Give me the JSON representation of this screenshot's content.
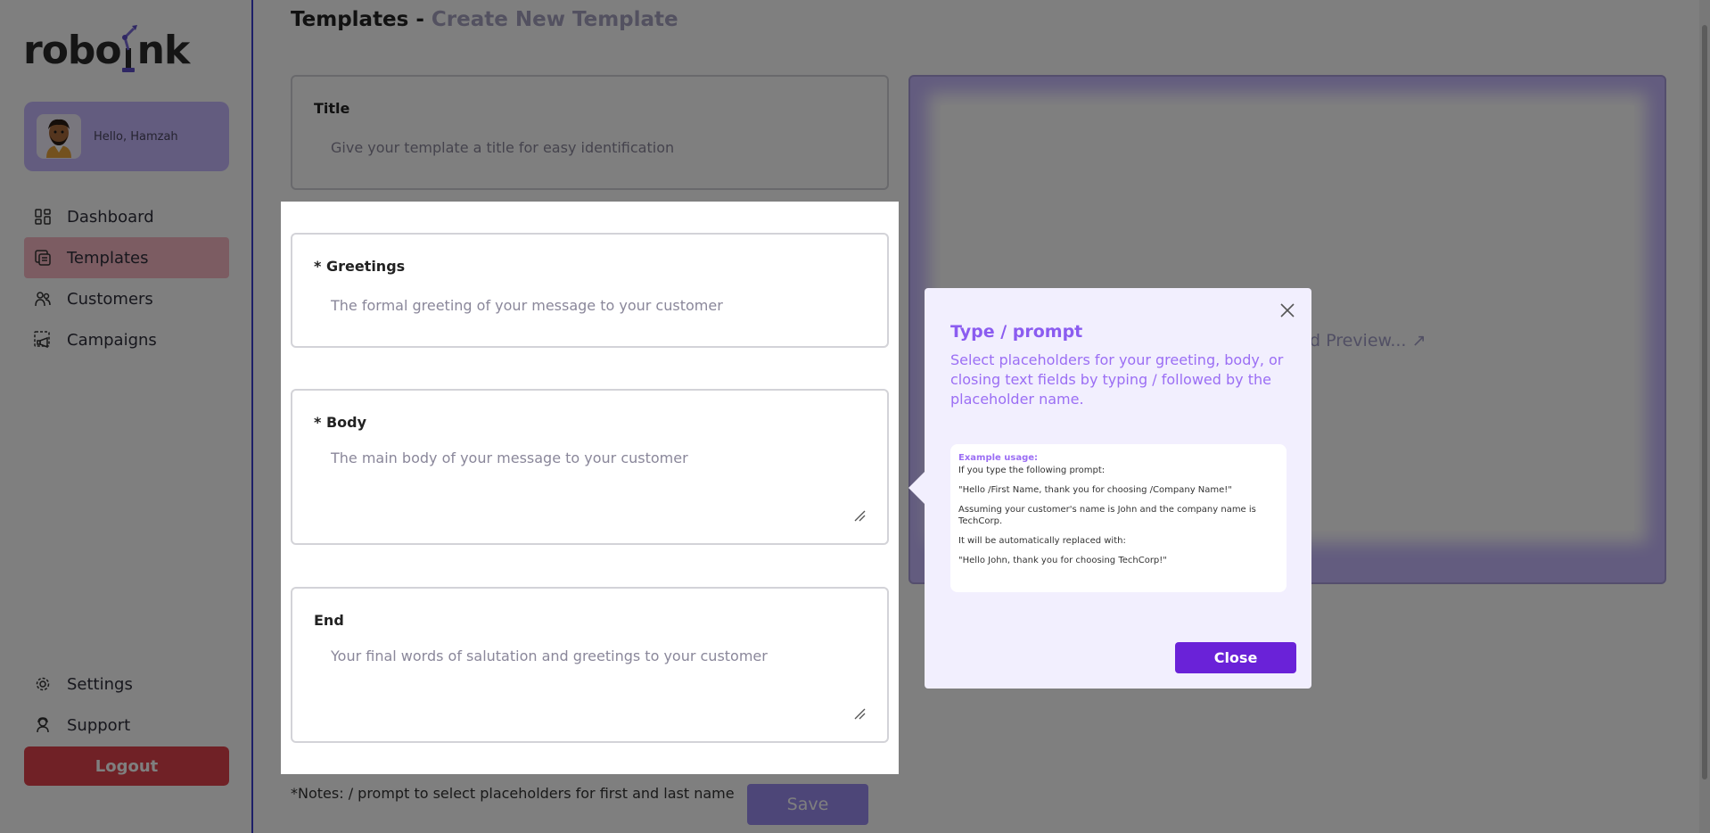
{
  "brand": {
    "logo_text_left": "robo",
    "logo_text_right": "nk"
  },
  "user": {
    "greeting": "Hello, Hamzah"
  },
  "sidebar": {
    "items": [
      {
        "label": "Dashboard",
        "icon": "dashboard-icon"
      },
      {
        "label": "Templates",
        "icon": "templates-icon",
        "active": true
      },
      {
        "label": "Customers",
        "icon": "customers-icon"
      },
      {
        "label": "Campaigns",
        "icon": "campaigns-icon"
      }
    ],
    "bottom_items": [
      {
        "label": "Settings",
        "icon": "gear-icon"
      },
      {
        "label": "Support",
        "icon": "support-icon"
      }
    ],
    "logout_label": "Logout"
  },
  "header": {
    "title": "Templates - ",
    "subtitle": "Create New Template"
  },
  "form": {
    "title": {
      "label": "Title",
      "placeholder": "Give your template a title for easy identification"
    },
    "greetings": {
      "label": "* Greetings",
      "placeholder": "The formal greeting of your message to your customer"
    },
    "body": {
      "label": "* Body",
      "placeholder": "The main body of your message to your customer"
    },
    "end": {
      "label": "End",
      "placeholder": "Your final words of salutation and greetings to your customer"
    },
    "notes": "*Notes: / prompt to select placeholders for first and last name",
    "save_label": "Save"
  },
  "preview": {
    "link_text": "d Preview..."
  },
  "popup": {
    "title": "Type / prompt",
    "description": "Select placeholders for your greeting, body, or closing text fields by typing / followed by the placeholder name.",
    "example": {
      "heading": "Example usage:",
      "line1": "If you type the following prompt:",
      "line2": "\"Hello /First Name, thank you for choosing /Company Name!\"",
      "line3": "Assuming your customer's name is John and the company name is TechCorp.",
      "line4": "It will be automatically replaced with:",
      "line5": "\"Hello John, thank you for choosing TechCorp!\""
    },
    "close_label": "Close"
  },
  "colors": {
    "accent": "#6a22d8",
    "user_card": "#c7b8ff",
    "active_nav": "#f8b8c4",
    "logout": "#e0424c",
    "popup_bg": "#f2effe",
    "popup_text": "#9b6ef4"
  }
}
